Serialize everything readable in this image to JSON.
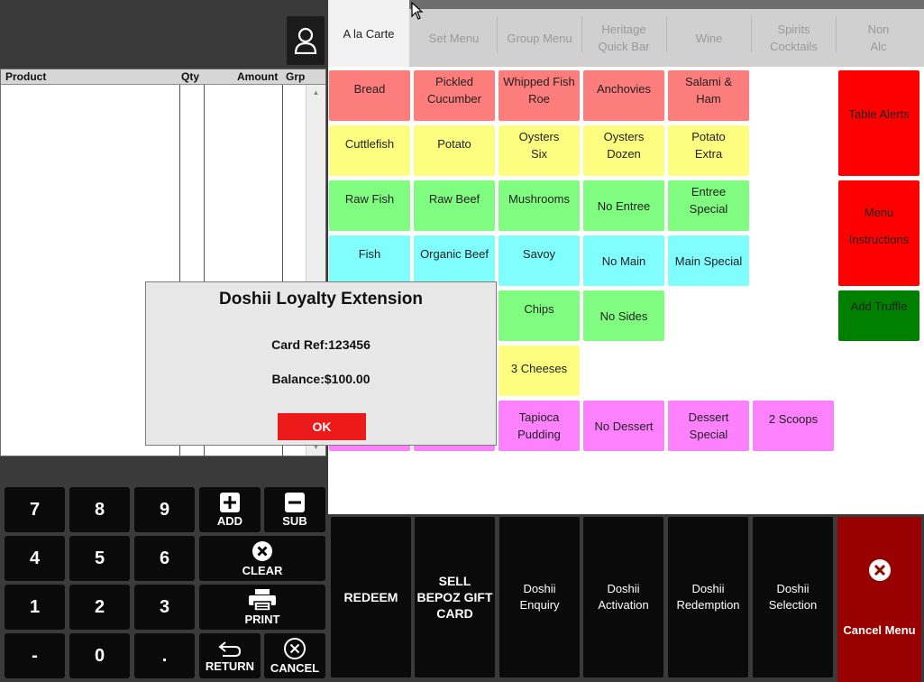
{
  "order_list": {
    "columns": [
      "Product",
      "Qty",
      "Amount",
      "Grp"
    ]
  },
  "keypad": {
    "digits": [
      "7",
      "8",
      "9",
      "4",
      "5",
      "6",
      "1",
      "2",
      "3",
      "-",
      "0",
      "."
    ],
    "add_label": "ADD",
    "sub_label": "SUB",
    "clear_label": "CLEAR",
    "print_label": "PRINT",
    "return_label": "RETURN",
    "cancel_label": "CANCEL"
  },
  "tabs": [
    {
      "label": "A la Carte",
      "active": true
    },
    {
      "label": "Set Menu"
    },
    {
      "label": "Group Menu"
    },
    {
      "label": "Heritage Quick Bar"
    },
    {
      "label": "Wine"
    },
    {
      "label": "Spirits Cocktails"
    },
    {
      "label": "Non Alc"
    }
  ],
  "menu": {
    "items": [
      {
        "label": "Bread",
        "color": "#fd7d7d"
      },
      {
        "label": "Pickled Cucumber",
        "color": "#fd7d7d"
      },
      {
        "label": "Whipped Fish Roe",
        "color": "#fd7d7d"
      },
      {
        "label": "Anchovies",
        "color": "#fd7d7d"
      },
      {
        "label": "Salami & Ham",
        "color": "#fd7d7d"
      },
      {
        "label": "Cuttlefish",
        "color": "#fdfd80"
      },
      {
        "label": "Potato",
        "color": "#fdfd80"
      },
      {
        "label": "Oysters Six",
        "color": "#fdfd80"
      },
      {
        "label": "Oysters Dozen",
        "color": "#fdfd80"
      },
      {
        "label": "Potato Extra",
        "color": "#fdfd80"
      },
      {
        "label": "Raw Fish",
        "color": "#80fd80"
      },
      {
        "label": "Raw Beef",
        "color": "#80fd80"
      },
      {
        "label": "Mushrooms",
        "color": "#80fd80"
      },
      {
        "label": "No Entree",
        "color": "#80fd80"
      },
      {
        "label": "Entree Special",
        "color": "#80fd80"
      },
      {
        "label": "Fish",
        "color": "#80fdfd"
      },
      {
        "label": "Organic Beef",
        "color": "#80fdfd"
      },
      {
        "label": "Savoy",
        "color": "#80fdfd"
      },
      {
        "label": "No Main",
        "color": "#80fdfd"
      },
      {
        "label": "Main Special",
        "color": "#80fdfd"
      },
      {
        "label": "Chips",
        "color": "#80fd80"
      },
      {
        "label": "No Sides",
        "color": "#80fd80"
      },
      {
        "label": "3 Cheeses",
        "color": "#fdfd80"
      },
      {
        "label": "Tapioca Pudding",
        "color": "#fd80fd"
      },
      {
        "label": "No Dessert",
        "color": "#fd80fd"
      },
      {
        "label": "Dessert Special",
        "color": "#fd80fd"
      },
      {
        "label": "2 Scoops",
        "color": "#fd80fd"
      }
    ],
    "side": [
      {
        "label": "Table Alerts",
        "color": "#ff0000"
      },
      {
        "label": "Menu Instructions",
        "color": "#ff0000"
      },
      {
        "label": "Add Truffle",
        "color": "#008000"
      }
    ]
  },
  "function_bar": {
    "redeem": "REDEEM",
    "sell_gift_card": "SELL BEPOZ GIFT CARD",
    "doshii_enquiry": "Doshii Enquiry",
    "doshii_activation": "Doshii Activation",
    "doshii_redemption": "Doshii Redemption",
    "doshii_selection": "Doshii Selection",
    "cancel_menu": "Cancel Menu"
  },
  "dialog": {
    "title": "Doshii Loyalty Extension",
    "card_ref": "Card Ref:123456",
    "balance": "Balance:$100.00",
    "ok": "OK"
  },
  "icons": {
    "user": "user-icon",
    "add": "plus-icon",
    "sub": "minus-icon",
    "clear": "close-circle-icon",
    "print": "printer-icon",
    "return": "return-arrow-icon",
    "cancel": "close-circle-icon",
    "cancel_menu": "close-circle-icon"
  }
}
